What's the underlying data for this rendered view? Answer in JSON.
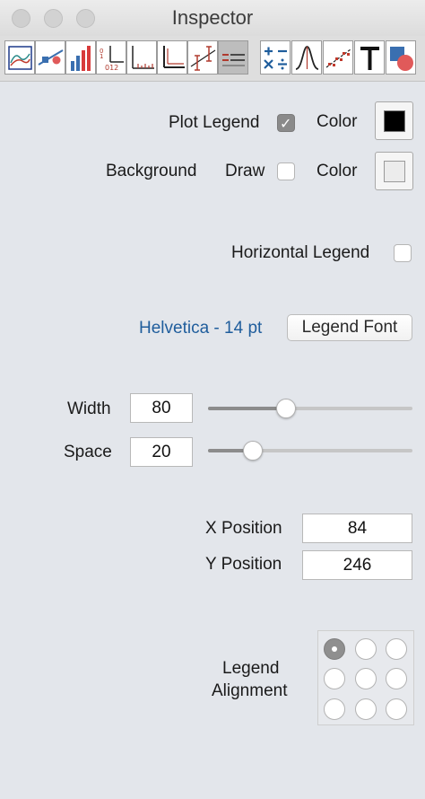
{
  "window": {
    "title": "Inspector"
  },
  "toolbar": {
    "icons": [
      "plot-frame-icon",
      "line-scatter-icon",
      "bar-chart-icon",
      "axis-numbers-icon",
      "tick-marks-icon",
      "axis-lines-icon",
      "error-bars-icon",
      "legend-icon",
      "math-operators-icon",
      "curve-fit-icon",
      "regression-icon",
      "text-tool-icon",
      "shapes-icon"
    ],
    "active_index": 7
  },
  "legend": {
    "plot_legend_label": "Plot Legend",
    "plot_legend_checked": true,
    "color_label": "Color",
    "legend_color": "#000000",
    "background_label": "Background",
    "draw_label": "Draw",
    "draw_checked": false,
    "background_color_label": "Color",
    "background_color": "#ececec",
    "horizontal_label": "Horizontal Legend",
    "horizontal_checked": false,
    "font_label": "Helvetica - 14 pt",
    "font_button": "Legend Font",
    "width_label": "Width",
    "width_value": "80",
    "width_slider_fraction": 0.38,
    "space_label": "Space",
    "space_value": "20",
    "space_slider_fraction": 0.22,
    "x_position_label": "X Position",
    "x_position_value": "84",
    "y_position_label": "Y Position",
    "y_position_value": "246",
    "alignment_label_line1": "Legend",
    "alignment_label_line2": "Alignment",
    "alignment_selected": "top-left"
  },
  "colors": {
    "link_blue": "#1f5d9c",
    "panel_bg": "#e3e6eb"
  }
}
